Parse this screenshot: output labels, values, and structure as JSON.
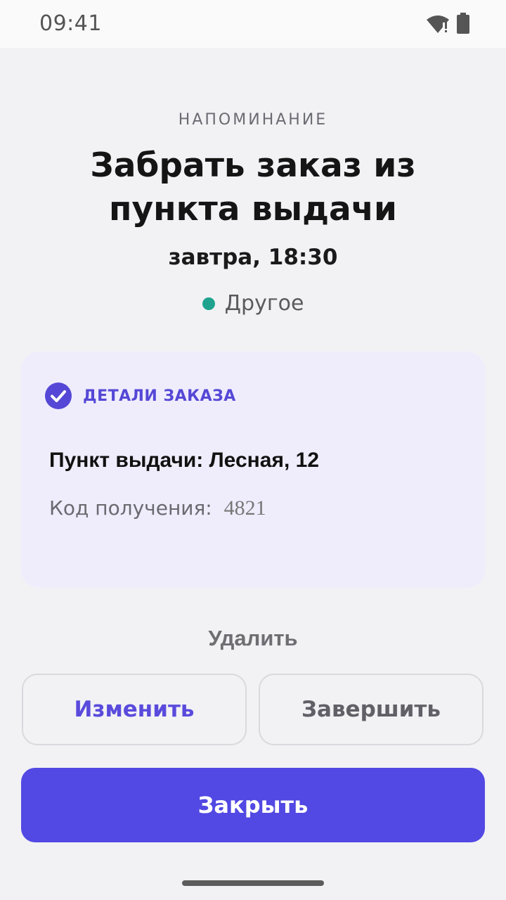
{
  "status_bar": {
    "time": "09:41",
    "wifi_icon": "wifi-icon",
    "battery_icon": "battery-icon"
  },
  "reminder": {
    "eyebrow": "НАПОМИНАНИЕ",
    "title": "Забрать заказ из пункта выдачи",
    "when": "завтра, 18:30",
    "category": "Другое",
    "category_color": "#1fa38f"
  },
  "details": {
    "header_icon": "check-circle-icon",
    "header": "ДЕТАЛИ ЗАКАЗА",
    "pickup_point": "Пункт выдачи: Лесная, 12",
    "code_label": "Код получения:",
    "code_value": "4821"
  },
  "actions": {
    "delete": "Удалить",
    "edit": "Изменить",
    "finish": "Завершить",
    "close": "Закрыть"
  },
  "colors": {
    "accent": "#5248E3",
    "card_bg": "#EFEDFC",
    "background": "#F2F2F5"
  }
}
